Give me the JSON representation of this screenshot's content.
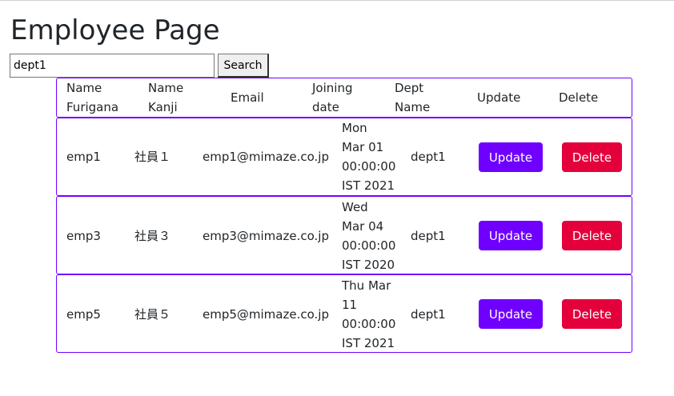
{
  "page": {
    "title": "Employee Page"
  },
  "search": {
    "value": "dept1",
    "button_label": "Search"
  },
  "table": {
    "headers": {
      "furigana": [
        "Name",
        "Furigana"
      ],
      "kanji": [
        "Name",
        "Kanji"
      ],
      "email": "Email",
      "joining": [
        "Joining",
        "date"
      ],
      "dept": [
        "Dept",
        "Name"
      ],
      "update": "Update",
      "delete": "Delete"
    },
    "rows": [
      {
        "furigana": "emp1",
        "kanji": "社員１",
        "email": "emp1@mimaze.co.jp",
        "joining": [
          "Mon",
          "Mar 01",
          "00:00:00",
          "IST 2021"
        ],
        "dept": "dept1",
        "update_label": "Update",
        "delete_label": "Delete"
      },
      {
        "furigana": "emp3",
        "kanji": "社員３",
        "email": "emp3@mimaze.co.jp",
        "joining": [
          "Wed",
          "Mar 04",
          "00:00:00",
          "IST 2020"
        ],
        "dept": "dept1",
        "update_label": "Update",
        "delete_label": "Delete"
      },
      {
        "furigana": "emp5",
        "kanji": "社員５",
        "email": "emp5@mimaze.co.jp",
        "joining": [
          "Thu Mar",
          "11",
          "00:00:00",
          "IST 2021"
        ],
        "dept": "dept1",
        "update_label": "Update",
        "delete_label": "Delete"
      }
    ]
  },
  "colors": {
    "border": "#6f00ff",
    "update_button": "#6f00ff",
    "delete_button": "#e4003b"
  }
}
